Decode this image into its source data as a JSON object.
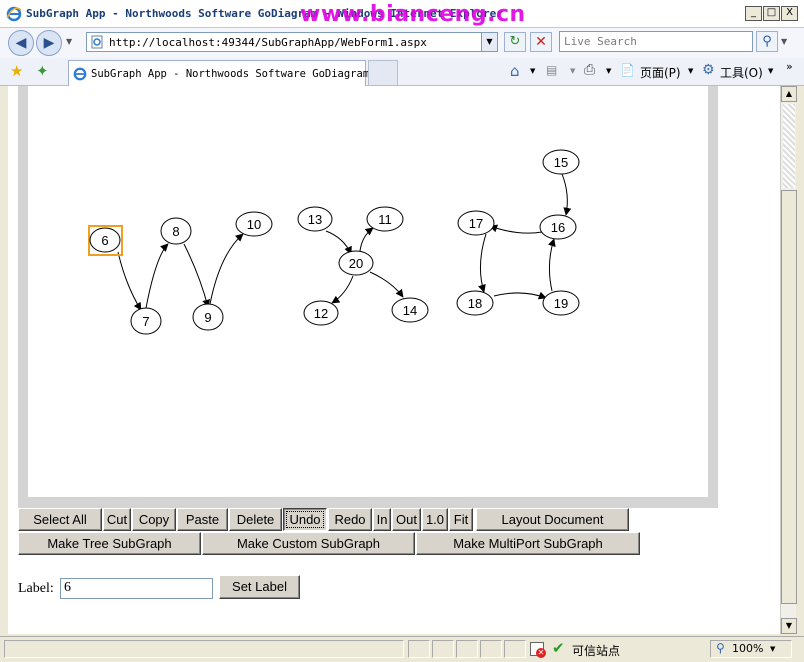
{
  "window": {
    "title": "SubGraph App - Northwoods Software GoDiagram - Windows Internet Explorer",
    "watermark": "www.bianceng.cn",
    "minimize": "_",
    "maximize": "□",
    "close": "X"
  },
  "address": {
    "url": "http://localhost:49344/SubGraphApp/WebForm1.aspx"
  },
  "search": {
    "placeholder": "Live Search"
  },
  "tab": {
    "label": "SubGraph App - Northwoods Software GoDiagram"
  },
  "toolbar": {
    "page": "页面(P)",
    "tools": "工具(O)"
  },
  "diagram": {
    "selected": "6",
    "nodes": [
      {
        "id": "6",
        "label": "6"
      },
      {
        "id": "7",
        "label": "7"
      },
      {
        "id": "8",
        "label": "8"
      },
      {
        "id": "9",
        "label": "9"
      },
      {
        "id": "10",
        "label": "10"
      },
      {
        "id": "11",
        "label": "11"
      },
      {
        "id": "12",
        "label": "12"
      },
      {
        "id": "13",
        "label": "13"
      },
      {
        "id": "14",
        "label": "14"
      },
      {
        "id": "15",
        "label": "15"
      },
      {
        "id": "16",
        "label": "16"
      },
      {
        "id": "17",
        "label": "17"
      },
      {
        "id": "18",
        "label": "18"
      },
      {
        "id": "19",
        "label": "19"
      },
      {
        "id": "20",
        "label": "20"
      }
    ],
    "links": [
      [
        "6",
        "7"
      ],
      [
        "7",
        "8"
      ],
      [
        "8",
        "9"
      ],
      [
        "9",
        "10"
      ],
      [
        "13",
        "20"
      ],
      [
        "20",
        "11"
      ],
      [
        "20",
        "12"
      ],
      [
        "20",
        "14"
      ],
      [
        "15",
        "16"
      ],
      [
        "16",
        "17"
      ],
      [
        "17",
        "18"
      ],
      [
        "18",
        "19"
      ],
      [
        "19",
        "16"
      ]
    ]
  },
  "buttons": {
    "select_all": "Select All",
    "cut": "Cut",
    "copy": "Copy",
    "paste": "Paste",
    "delete": "Delete",
    "undo": "Undo",
    "redo": "Redo",
    "zoom_in": "In",
    "zoom_out": "Out",
    "zoom_reset": "1.0",
    "fit": "Fit",
    "layout": "Layout Document",
    "make_tree": "Make Tree SubGraph",
    "make_custom": "Make Custom SubGraph",
    "make_multiport": "Make MultiPort SubGraph",
    "set_label": "Set Label"
  },
  "label_form": {
    "caption": "Label:",
    "value": "6"
  },
  "status": {
    "zone": "可信站点",
    "zoom": "100%"
  }
}
